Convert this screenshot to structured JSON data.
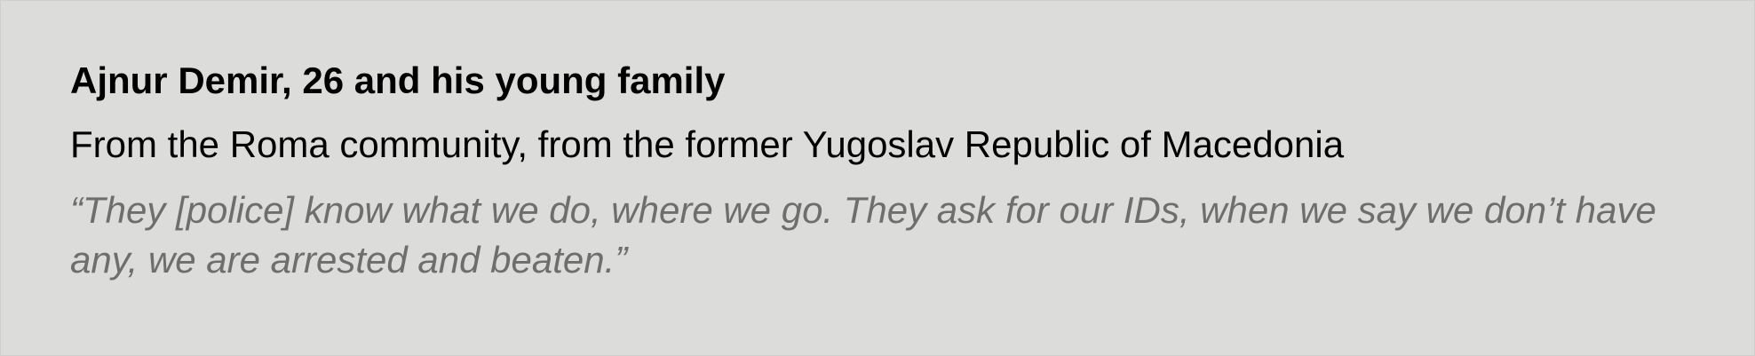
{
  "profile": {
    "name": "Ajnur Demir, 26 and his young family",
    "origin": "From the Roma community, from the former Yugoslav Republic of Macedonia",
    "quote": "“They [police] know what we do, where we go. They ask for our IDs, when we say we don’t have any, we are arrested and beaten.”"
  },
  "colors": {
    "background": "#dcdcda",
    "heading": "#000000",
    "quote": "#6e6e6e"
  }
}
